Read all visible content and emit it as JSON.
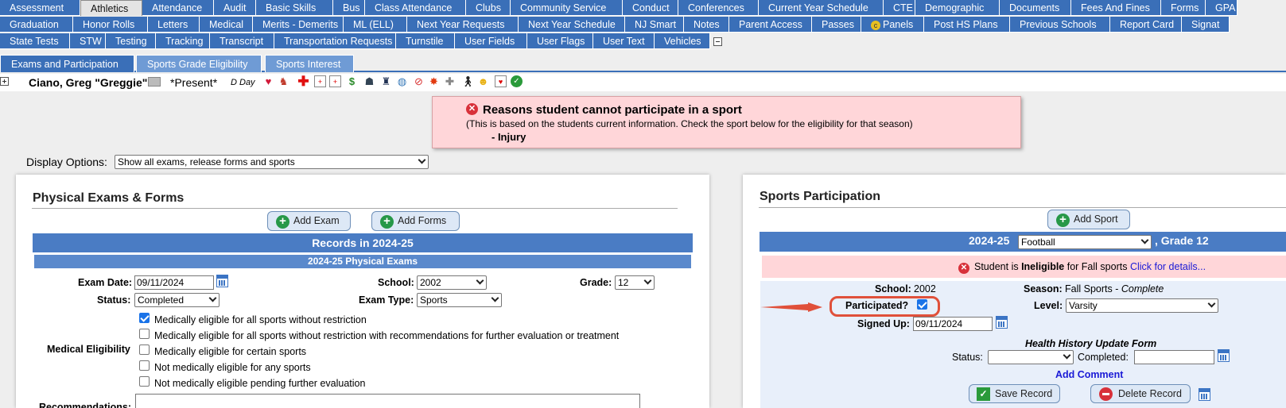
{
  "tabs_row1": [
    "Assessment",
    "Athletics",
    "Attendance",
    "Audit",
    "Basic Skills",
    "Bus",
    "Class Attendance",
    "Clubs",
    "Community Service",
    "Conduct",
    "Conferences",
    "Current Year Schedule",
    "CTE",
    "Demographic",
    "Documents",
    "Fees And Fines",
    "Forms",
    "GPA"
  ],
  "tabs_row2": [
    "Graduation",
    "Honor Rolls",
    "Letters",
    "Medical",
    "Merits - Demerits",
    "ML (ELL)",
    "Next Year Requests",
    "Next Year Schedule",
    "NJ Smart",
    "Notes",
    "Parent Access",
    "Passes",
    "Panels",
    "Post HS Plans",
    "Previous Schools",
    "Report Card",
    "Signat"
  ],
  "tabs_row3": [
    "State Tests",
    "STW",
    "Testing",
    "Tracking",
    "Transcript",
    "Transportation Requests",
    "Turnstile",
    "User Fields",
    "User Flags",
    "User Text",
    "Vehicles"
  ],
  "active_tab": "Athletics",
  "subtabs": [
    "Exams and Participation",
    "Sports Grade Eligibility",
    "Sports Interest"
  ],
  "student": {
    "name": "Ciano, Greg \"Greggie\"",
    "status": "*Present*",
    "day": "D Day",
    "icons": [
      "heart-icon",
      "people-icon",
      "red-cross-icon",
      "medical-card-icon",
      "medical-card-icon",
      "dollar-icon",
      "person-icon",
      "graduate-icon",
      "globe-icon",
      "no-sign-icon",
      "burst-icon",
      "plus-icon",
      "walking-icon",
      "heart-eyes-icon",
      "card-icon",
      "check-circle-icon"
    ]
  },
  "alert": {
    "title": "Reasons student cannot participate in a sport",
    "subtitle": "(This is based on the students current information. Check the sport below for the eligibility for that season)",
    "reason": "- Injury"
  },
  "display_options": {
    "label": "Display Options:",
    "value": "Show all exams, release forms and sports"
  },
  "exams_panel": {
    "title": "Physical Exams & Forms",
    "add_exam": "Add Exam",
    "add_forms": "Add Forms",
    "records_header": "Records in 2024-25",
    "sub_header": "2024-25 Physical Exams",
    "exam_date_label": "Exam Date:",
    "exam_date": "09/11/2024",
    "school_label": "School:",
    "school": "2002",
    "grade_label": "Grade:",
    "grade": "12",
    "status_label": "Status:",
    "status": "Completed",
    "exam_type_label": "Exam Type:",
    "exam_type": "Sports",
    "medical_label": "Medical Eligibility",
    "eligibility_options": [
      {
        "label": "Medically eligible for all sports without restriction",
        "checked": true
      },
      {
        "label": "Medically eligible for all sports without restriction with recommendations for further evaluation or treatment",
        "checked": false
      },
      {
        "label": "Medically eligible for certain sports",
        "checked": false
      },
      {
        "label": "Not medically eligible for any sports",
        "checked": false
      },
      {
        "label": "Not medically eligible pending further evaluation",
        "checked": false
      }
    ],
    "recommendations_label": "Recommendations:"
  },
  "sports_panel": {
    "title": "Sports Participation",
    "add_sport": "Add Sport",
    "year": "2024-25",
    "sport": "Football",
    "grade": ", Grade 12",
    "inelig_prefix": "Student is ",
    "inelig_word": "Ineligible",
    "inelig_suffix": " for Fall sports ",
    "inelig_link": "Click for details...",
    "school_label": "School:",
    "school": "2002",
    "season_label": "Season:",
    "season": "Fall Sports - ",
    "season_status": "Complete",
    "participated_label": "Participated?",
    "participated": true,
    "level_label": "Level:",
    "level": "Varsity",
    "signed_up_label": "Signed Up:",
    "signed_up": "09/11/2024",
    "health_header": "Health History Update Form",
    "status_label": "Status:",
    "status": "",
    "completed_label": "Completed:",
    "completed": "",
    "add_comment": "Add Comment",
    "save": "Save Record",
    "delete": "Delete Record"
  },
  "colors": {
    "tab_blue": "#3a6fb8",
    "header_blue": "#4a7cc4",
    "alert_pink": "#ffd6d9",
    "highlight_red": "#e0503a"
  }
}
